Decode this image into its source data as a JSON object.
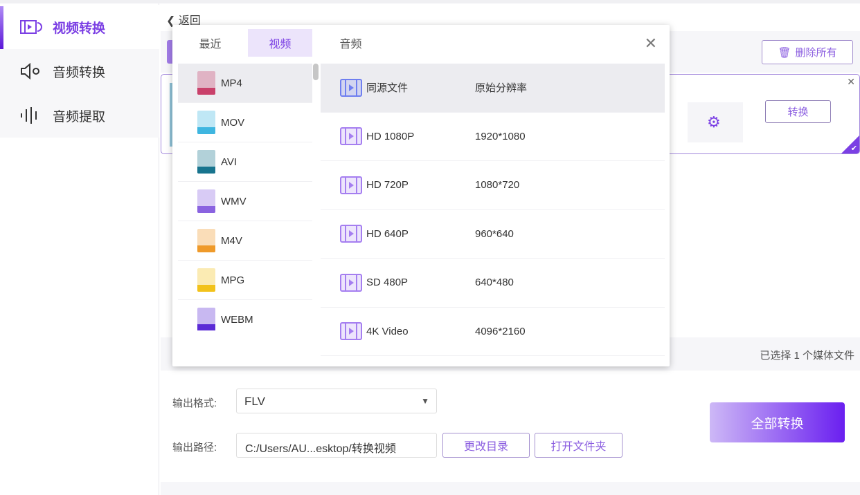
{
  "sidebar": {
    "items": [
      {
        "label": "视频转换",
        "icon": "video-convert-icon"
      },
      {
        "label": "音频转换",
        "icon": "audio-convert-icon"
      },
      {
        "label": "音频提取",
        "icon": "audio-extract-icon"
      }
    ]
  },
  "back_label": "返回",
  "toolbar": {
    "delete_all": "删除所有"
  },
  "file_card": {
    "convert": "转换"
  },
  "status": "已选择 1 个媒体文件",
  "output": {
    "format_label": "输出格式:",
    "format_value": "FLV",
    "path_label": "输出路径:",
    "path_value": "C:/Users/AU...esktop/转换视频",
    "change_dir": "更改目录",
    "open_folder": "打开文件夹",
    "convert_all": "全部转换"
  },
  "modal": {
    "tabs": [
      "最近",
      "视频",
      "音频"
    ],
    "formats": [
      {
        "label": "MP4",
        "color": "#c9416b"
      },
      {
        "label": "MOV",
        "color": "#3fb6e0"
      },
      {
        "label": "AVI",
        "color": "#18748e"
      },
      {
        "label": "WMV",
        "color": "#8a63e0"
      },
      {
        "label": "M4V",
        "color": "#ef9a2a"
      },
      {
        "label": "MPG",
        "color": "#f2c21b"
      },
      {
        "label": "WEBM",
        "color": "#5b2bd6"
      }
    ],
    "resolutions": [
      {
        "name": "同源文件",
        "value": "原始分辨率"
      },
      {
        "name": "HD 1080P",
        "value": "1920*1080"
      },
      {
        "name": "HD 720P",
        "value": "1080*720"
      },
      {
        "name": "HD 640P",
        "value": "960*640"
      },
      {
        "name": "SD 480P",
        "value": "640*480"
      },
      {
        "name": "4K Video",
        "value": "4096*2160"
      }
    ]
  },
  "colors": {
    "accent": "#7b3fe4"
  }
}
